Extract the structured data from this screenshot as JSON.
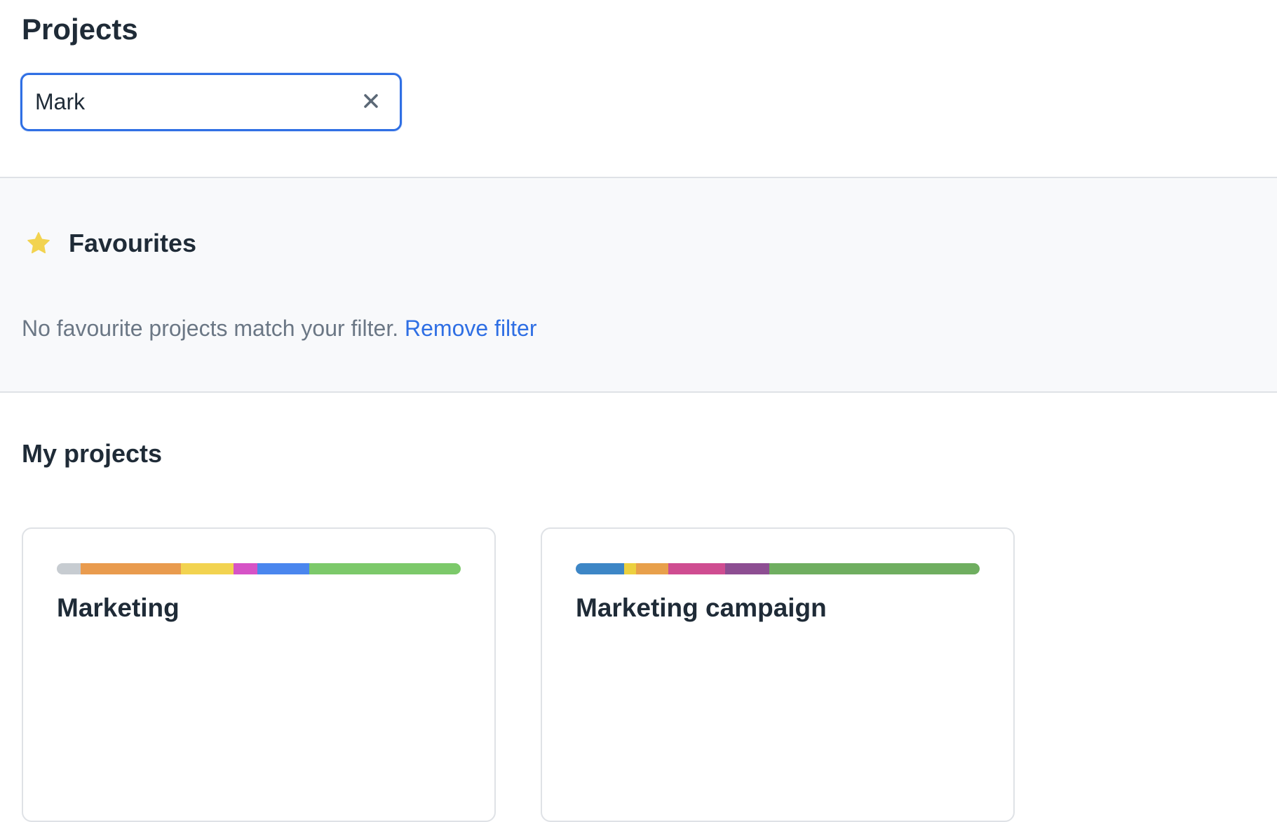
{
  "header": {
    "title": "Projects"
  },
  "search": {
    "value": "Mark",
    "clear_icon": "close-icon"
  },
  "favourites": {
    "title": "Favourites",
    "icon": "star-icon",
    "icon_color": "#f2d350",
    "empty_message": "No favourite projects match your filter.",
    "remove_filter_label": "Remove filter"
  },
  "my_projects": {
    "title": "My projects",
    "cards": [
      {
        "name": "Marketing",
        "color_bar": [
          {
            "color": "#c7ccd1",
            "share": 0.059
          },
          {
            "color": "#e99b4e",
            "share": 0.249
          },
          {
            "color": "#f2d350",
            "share": 0.129
          },
          {
            "color": "#d653c6",
            "share": 0.059
          },
          {
            "color": "#4a86ee",
            "share": 0.129
          },
          {
            "color": "#7cc96a",
            "share": 0.375
          }
        ]
      },
      {
        "name": "Marketing campaign",
        "color_bar": [
          {
            "color": "#3d86c6",
            "share": 0.119
          },
          {
            "color": "#ecd03f",
            "share": 0.03
          },
          {
            "color": "#e8a04b",
            "share": 0.08
          },
          {
            "color": "#cf4d91",
            "share": 0.141
          },
          {
            "color": "#8d4e92",
            "share": 0.109
          },
          {
            "color": "#6fae60",
            "share": 0.521
          }
        ]
      }
    ]
  }
}
